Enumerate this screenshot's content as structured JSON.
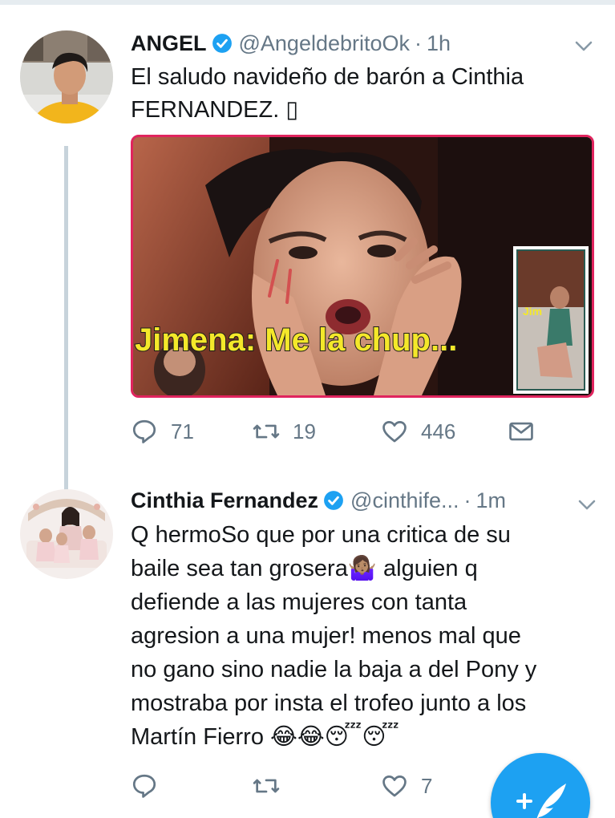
{
  "tweets": [
    {
      "name": "ANGEL",
      "handle": "@AngeldebritoOk",
      "dot": "·",
      "time": "1h",
      "text_lines": [
        "El saludo navideño de barón a Cinthia",
        "FERNANDEZ. ▯"
      ],
      "media_caption": "Jimena: Me la chup...",
      "media_inset_label": "Jim",
      "reply_count": "71",
      "retweet_count": "19",
      "like_count": "446"
    },
    {
      "name": "Cinthia Fernandez",
      "handle": "@cinthife...",
      "dot": "·",
      "time": "1m",
      "text_lines": [
        "Q hermoSo que por una critica de su",
        "baile sea tan grosera🤷🏽‍♀️ alguien q",
        "defiende a las mujeres con tanta",
        "agresion a una mujer!  menos mal que",
        "no gano sino nadie la baja a del Pony y",
        "mostraba por insta el trofeo junto a los",
        "Martín Fierro 😂😂😴😴"
      ],
      "like_count": "7"
    }
  ],
  "icons": {
    "verified": "verified-badge-icon",
    "chevron": "chevron-down-icon",
    "reply": "reply-icon",
    "retweet": "retweet-icon",
    "like": "heart-icon",
    "message": "envelope-icon",
    "compose": "compose-tweet-icon"
  },
  "colors": {
    "accent": "#1da1f2",
    "text": "#14171a",
    "muted": "#657786",
    "caption_yellow": "#f4e82a"
  }
}
